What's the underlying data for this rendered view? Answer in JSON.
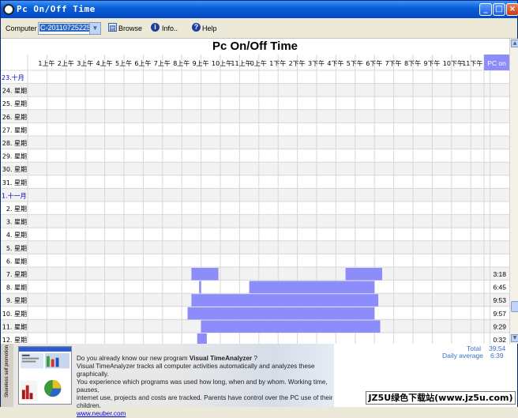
{
  "window": {
    "title": "Pc On/Off Time",
    "min": "_",
    "max": "□",
    "close": "×"
  },
  "toolbar": {
    "computer_label": "Computer",
    "computer_value": "C-20110725225C",
    "browse_label": "Browse",
    "info_label": "Info..",
    "help_label": "Help"
  },
  "main": {
    "title": "Pc On/Off Time"
  },
  "chart_data": {
    "type": "bar",
    "title": "Pc On/Off Time",
    "hour_labels": [
      "1上午",
      "2上午",
      "3上午",
      "4上午",
      "5上午",
      "6上午",
      "7上午",
      "8上午",
      "9上午",
      "10上午",
      "11上午",
      "0上午",
      "1下午",
      "2下午",
      "3下午",
      "4下午",
      "5下午",
      "6下午",
      "7下午",
      "8下午",
      "9下午",
      "10下午",
      "11下午"
    ],
    "pc_on_header": "PC on",
    "rows": [
      {
        "label": "23.十月",
        "month": true,
        "sessions": [],
        "total": ""
      },
      {
        "label": "24. 星期",
        "sessions": [],
        "total": ""
      },
      {
        "label": "25. 星期",
        "sessions": [],
        "total": ""
      },
      {
        "label": "26. 星期",
        "sessions": [],
        "total": ""
      },
      {
        "label": "27. 星期",
        "sessions": [],
        "total": ""
      },
      {
        "label": "28. 星期",
        "sessions": [],
        "total": ""
      },
      {
        "label": "29. 星期",
        "sessions": [],
        "total": ""
      },
      {
        "label": "30. 星期",
        "sessions": [],
        "total": ""
      },
      {
        "label": "31. 星期",
        "sessions": [],
        "total": ""
      },
      {
        "label": "1.十一月",
        "month": true,
        "sessions": [],
        "total": ""
      },
      {
        "label": "2. 星期",
        "sessions": [],
        "total": ""
      },
      {
        "label": "3. 星期",
        "sessions": [],
        "total": ""
      },
      {
        "label": "4. 星期",
        "sessions": [],
        "total": ""
      },
      {
        "label": "5. 星期",
        "sessions": [],
        "total": ""
      },
      {
        "label": "6. 星期",
        "sessions": [],
        "total": ""
      },
      {
        "label": "7. 星期",
        "sessions": [
          [
            8.5,
            9.9
          ],
          [
            16.5,
            18.4
          ]
        ],
        "total": "3:18"
      },
      {
        "label": "8. 星期",
        "sessions": [
          [
            8.9,
            9.0
          ],
          [
            11.5,
            18.0
          ]
        ],
        "total": "6:45"
      },
      {
        "label": "9. 星期",
        "sessions": [
          [
            8.5,
            18.2
          ]
        ],
        "total": "9:53"
      },
      {
        "label": "10. 星期",
        "sessions": [
          [
            8.3,
            18.0
          ]
        ],
        "total": "9:57"
      },
      {
        "label": "11. 星期",
        "sessions": [
          [
            9.0,
            18.3
          ]
        ],
        "total": "9:29"
      },
      {
        "label": "12. 星期",
        "sessions": [
          [
            8.8,
            9.3
          ]
        ],
        "total": "0:32"
      }
    ]
  },
  "summary": {
    "total_label": "Total",
    "total_value": "39:54",
    "avg_label": "Daily average",
    "avg_value": "6:39"
  },
  "promo": {
    "side_label": "Shareless self promotion",
    "line1_pre": "Do you already know our new program ",
    "line1_bold": "Visual TimeAnalyzer",
    "line1_post": " ?",
    "line2": "Visual TimeAnalyzer tracks all computer activities automatically and analyzes these graphically.",
    "line3": "You experience which programs was used how long, when and by whom. Working time, pauses,",
    "line4": "internet use, projects and costs are tracked. Parents have control over the PC use of their children.",
    "link": "www.neuber.com"
  },
  "watermark": "JZ5U绿色下载站(www.jz5u.com)",
  "colors": {
    "bar": "#8c8cfa",
    "month": "#0000cc",
    "pc_on_header_bg": "#8c8cfa",
    "grid": "#d7d7d7",
    "stripe": "#f2f2f2"
  }
}
